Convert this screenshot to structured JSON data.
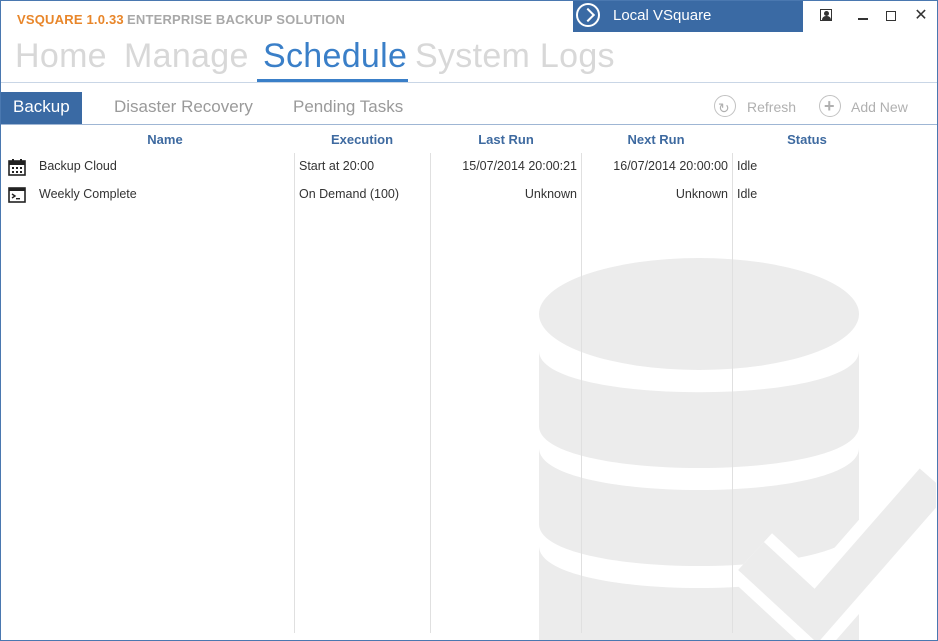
{
  "window": {
    "app_name": "VSQUARE 1.0.33",
    "app_subtitle": "ENTERPRISE BACKUP SOLUTION",
    "server_label": "Local VSquare"
  },
  "main_nav": {
    "items": [
      "Home",
      "Manage",
      "Schedule",
      "System Logs"
    ],
    "active": "Schedule"
  },
  "sub_tabs": {
    "items": [
      "Backup",
      "Disaster Recovery",
      "Pending Tasks"
    ],
    "active": "Backup"
  },
  "toolbar": {
    "refresh_label": "Refresh",
    "add_new_label": "Add New"
  },
  "table": {
    "columns": [
      "Name",
      "Execution",
      "Last Run",
      "Next Run",
      "Status"
    ],
    "rows": [
      {
        "icon": "calendar-icon",
        "name": "Backup Cloud",
        "execution": "Start at 20:00",
        "last_run": "15/07/2014 20:00:21",
        "next_run": "16/07/2014 20:00:00",
        "status": "Idle"
      },
      {
        "icon": "terminal-icon",
        "name": "Weekly Complete",
        "execution": "On Demand (100)",
        "last_run": "Unknown",
        "next_run": "Unknown",
        "status": "Idle"
      }
    ]
  },
  "colors": {
    "accent": "#3a7fc8",
    "brand_orange": "#e8862a",
    "header_blue": "#3a6aa4",
    "watermark": "#ececec"
  }
}
